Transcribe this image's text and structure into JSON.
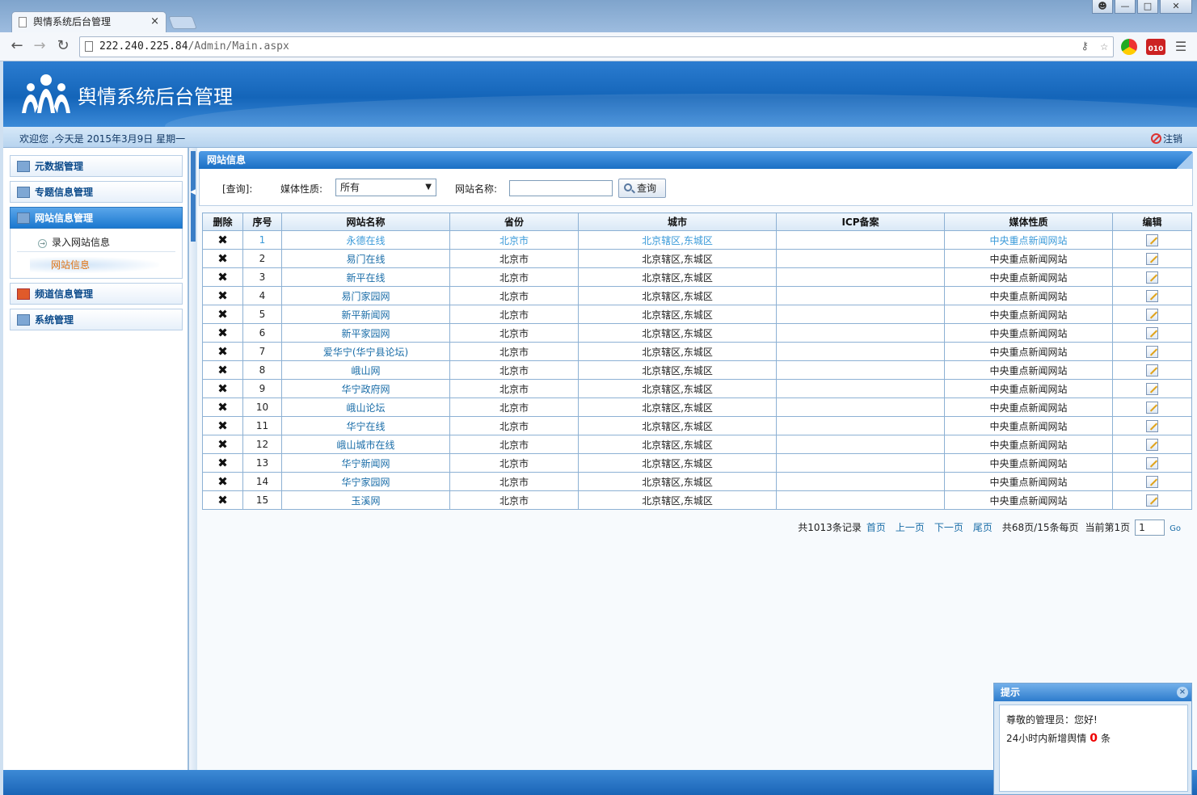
{
  "browser": {
    "tab_title": "舆情系统后台管理",
    "tab_close": "×",
    "url_host": "222.240.225.84",
    "url_path": "/Admin/Main.aspx",
    "ext_badge": "010"
  },
  "header": {
    "title": "舆情系统后台管理",
    "welcome": "欢迎您 ,今天是 2015年3月9日 星期一",
    "logout": "注销"
  },
  "sidebar": {
    "menus": [
      {
        "label": "元数据管理"
      },
      {
        "label": "专题信息管理"
      },
      {
        "label": "网站信息管理"
      },
      {
        "label": "频道信息管理"
      },
      {
        "label": "系统管理"
      }
    ],
    "sub_items": [
      {
        "label": "录入网站信息"
      },
      {
        "label": "网站信息"
      }
    ]
  },
  "panel": {
    "title": "网站信息"
  },
  "query": {
    "label": "[查询]:",
    "media_label": "媒体性质:",
    "media_value": "所有",
    "site_label": "网站名称:",
    "site_value": "",
    "button": "查询"
  },
  "table": {
    "headers": [
      "删除",
      "序号",
      "网站名称",
      "省份",
      "城市",
      "ICP备案",
      "媒体性质",
      "编辑"
    ],
    "rows": [
      {
        "no": "1",
        "name": "永德在线",
        "province": "北京市",
        "city": "北京辖区,东城区",
        "icp": "",
        "media": "中央重点新闻网站"
      },
      {
        "no": "2",
        "name": "易门在线",
        "province": "北京市",
        "city": "北京辖区,东城区",
        "icp": "",
        "media": "中央重点新闻网站"
      },
      {
        "no": "3",
        "name": "新平在线",
        "province": "北京市",
        "city": "北京辖区,东城区",
        "icp": "",
        "media": "中央重点新闻网站"
      },
      {
        "no": "4",
        "name": "易门家园网",
        "province": "北京市",
        "city": "北京辖区,东城区",
        "icp": "",
        "media": "中央重点新闻网站"
      },
      {
        "no": "5",
        "name": "新平新闻网",
        "province": "北京市",
        "city": "北京辖区,东城区",
        "icp": "",
        "media": "中央重点新闻网站"
      },
      {
        "no": "6",
        "name": "新平家园网",
        "province": "北京市",
        "city": "北京辖区,东城区",
        "icp": "",
        "media": "中央重点新闻网站"
      },
      {
        "no": "7",
        "name": "爱华宁(华宁县论坛)",
        "province": "北京市",
        "city": "北京辖区,东城区",
        "icp": "",
        "media": "中央重点新闻网站"
      },
      {
        "no": "8",
        "name": "峨山网",
        "province": "北京市",
        "city": "北京辖区,东城区",
        "icp": "",
        "media": "中央重点新闻网站"
      },
      {
        "no": "9",
        "name": "华宁政府网",
        "province": "北京市",
        "city": "北京辖区,东城区",
        "icp": "",
        "media": "中央重点新闻网站"
      },
      {
        "no": "10",
        "name": "峨山论坛",
        "province": "北京市",
        "city": "北京辖区,东城区",
        "icp": "",
        "media": "中央重点新闻网站"
      },
      {
        "no": "11",
        "name": "华宁在线",
        "province": "北京市",
        "city": "北京辖区,东城区",
        "icp": "",
        "media": "中央重点新闻网站"
      },
      {
        "no": "12",
        "name": "峨山城市在线",
        "province": "北京市",
        "city": "北京辖区,东城区",
        "icp": "",
        "media": "中央重点新闻网站"
      },
      {
        "no": "13",
        "name": "华宁新闻网",
        "province": "北京市",
        "city": "北京辖区,东城区",
        "icp": "",
        "media": "中央重点新闻网站"
      },
      {
        "no": "14",
        "name": "华宁家园网",
        "province": "北京市",
        "city": "北京辖区,东城区",
        "icp": "",
        "media": "中央重点新闻网站"
      },
      {
        "no": "15",
        "name": "玉溪网",
        "province": "北京市",
        "city": "北京辖区,东城区",
        "icp": "",
        "media": "中央重点新闻网站"
      }
    ],
    "delete_glyph": "✖"
  },
  "pager": {
    "total": "共1013条记录",
    "first": "首页",
    "prev": "上一页",
    "next": "下一页",
    "last": "尾页",
    "summary": "共68页/15条每页",
    "current_label": "当前第1页",
    "page_value": "1",
    "go": "Go"
  },
  "notice": {
    "title": "提示",
    "close": "×",
    "greeting": "尊敬的管理员：您好!",
    "prefix": "24小时内新增舆情",
    "count": "0",
    "suffix": "条"
  }
}
